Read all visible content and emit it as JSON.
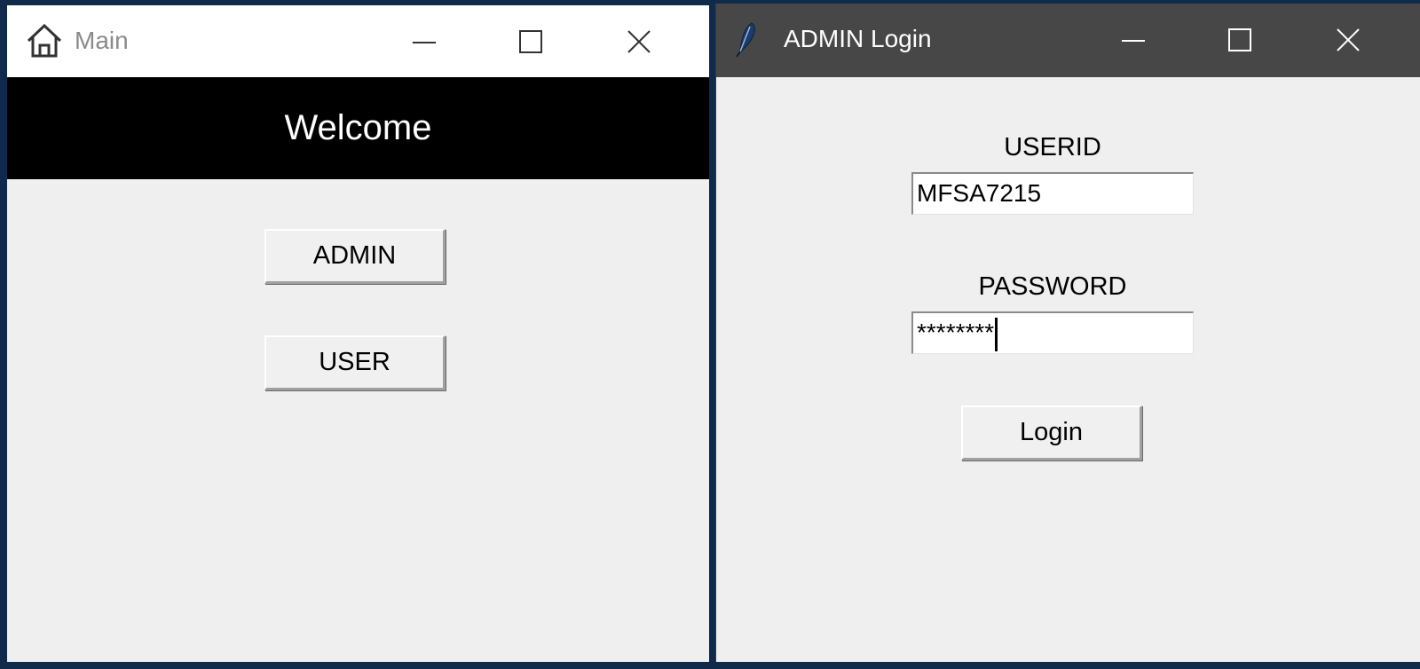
{
  "main_window": {
    "title": "Main",
    "icon": "home-icon",
    "banner": "Welcome",
    "buttons": {
      "admin": "ADMIN",
      "user": "USER"
    }
  },
  "login_window": {
    "title": "ADMIN Login",
    "icon": "feather-icon",
    "userid_label": "USERID",
    "userid_value": "MFSA7215",
    "password_label": "PASSWORD",
    "password_value": "********",
    "login_button": "Login"
  },
  "colors": {
    "banner_bg": "#000000",
    "login_titlebar": "#474747",
    "window_bg": "#efefef"
  }
}
